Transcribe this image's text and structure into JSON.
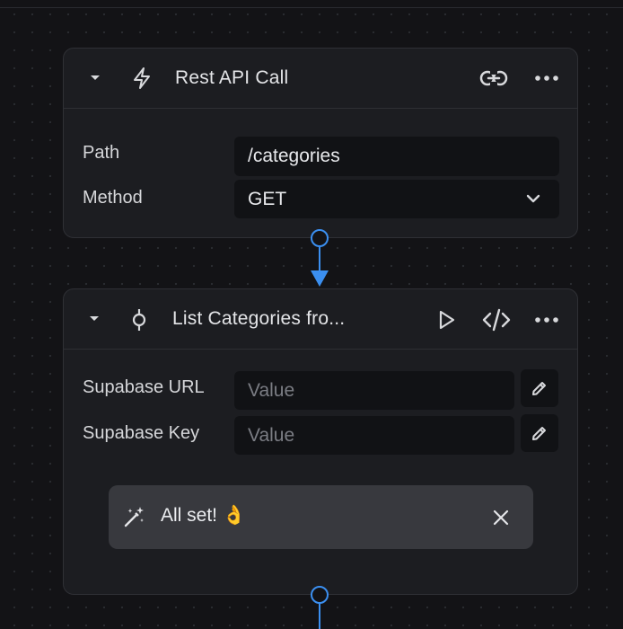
{
  "nodes": [
    {
      "title": "Rest API Call",
      "icons": [
        "chevron-down-icon",
        "lightning-icon",
        "link-icon",
        "more-icon"
      ],
      "fields": [
        {
          "label": "Path",
          "value": "/categories"
        },
        {
          "label": "Method",
          "value": "GET"
        }
      ]
    },
    {
      "title": "List Categories fro...",
      "icons": [
        "chevron-down-icon",
        "commit-icon",
        "play-icon",
        "code-icon",
        "more-icon"
      ],
      "fields": [
        {
          "label": "Supabase URL",
          "placeholder": "Value"
        },
        {
          "label": "Supabase Key",
          "placeholder": "Value"
        }
      ],
      "toast": {
        "text": "All set! 👌",
        "icon": "magic-wand-icon"
      }
    }
  ],
  "colors": {
    "canvas": "#131316",
    "node_bg": "#1c1d21",
    "field_bg": "#111215",
    "connector": "#3b8ff0",
    "toast_bg": "#38393e"
  }
}
